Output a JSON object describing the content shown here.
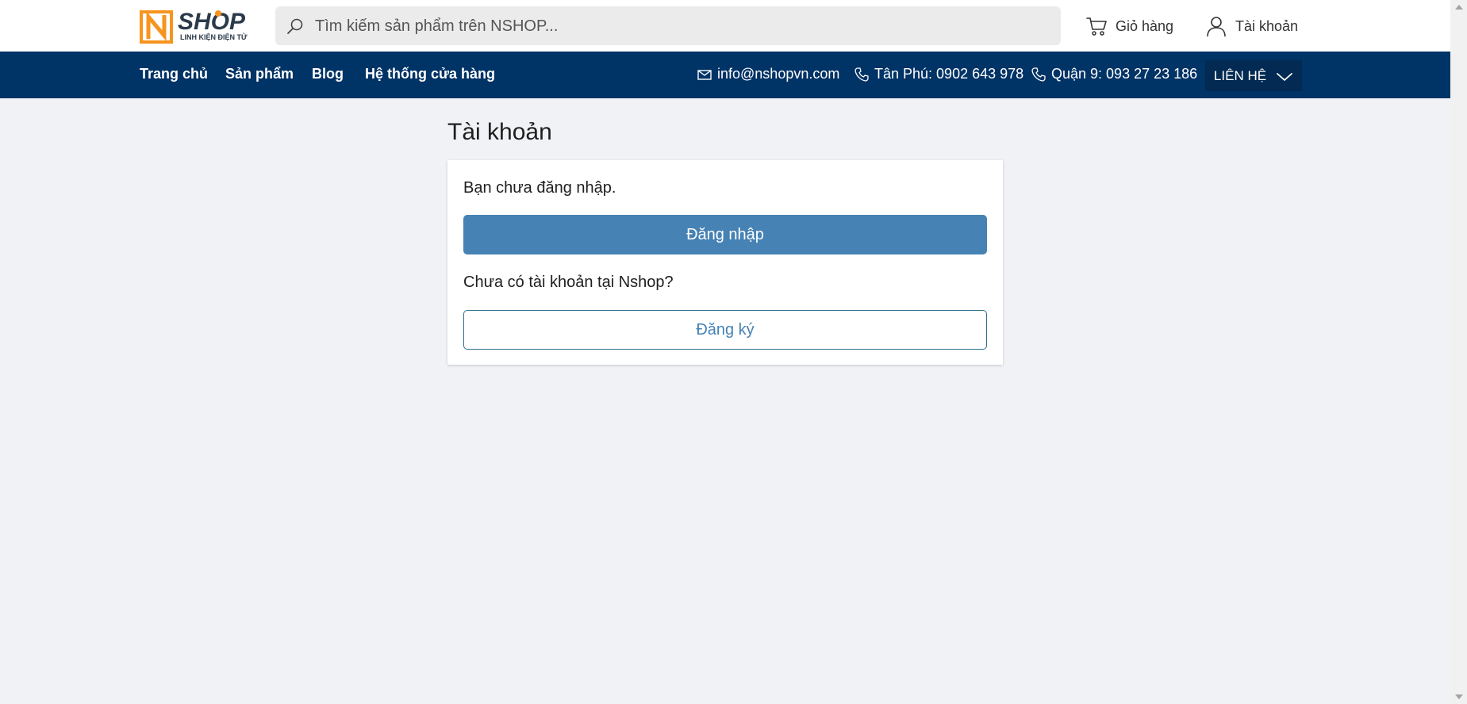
{
  "header": {
    "logo": {
      "brand": "SHOP",
      "tagline": "LINH KIỆN ĐIỆN TỬ",
      "icon": "n-logo-icon"
    },
    "search": {
      "placeholder": "Tìm kiếm sản phẩm trên NSHOP...",
      "value": "",
      "icon": "search-icon"
    },
    "cart": {
      "label": "Giỏ hàng",
      "icon": "cart-icon"
    },
    "account": {
      "label": "Tài khoản",
      "icon": "user-icon"
    }
  },
  "nav": {
    "items": [
      {
        "label": "Trang chủ"
      },
      {
        "label": "Sản phẩm"
      },
      {
        "label": "Blog"
      },
      {
        "label": "Hệ thống cửa hàng"
      }
    ],
    "contacts": [
      {
        "label": "info@nshopvn.com",
        "icon": "mail-icon"
      },
      {
        "label": "Tân Phú: 0902 643 978",
        "icon": "phone-icon"
      },
      {
        "label": "Quận 9: 093 27 23 186",
        "icon": "phone-icon"
      }
    ],
    "contact_button": {
      "label": "LIÊN HỆ",
      "icon": "chevron-down-icon"
    }
  },
  "main": {
    "title": "Tài khoản",
    "not_logged_in": "Bạn chưa đăng nhập.",
    "login_button": "Đăng nhập",
    "no_account_question": "Chưa có tài khoản tại Nshop?",
    "register_button": "Đăng ký"
  },
  "colors": {
    "navbar": "#003366",
    "contact_button": "#022a52",
    "primary_button": "#4682b4",
    "logo_orange": "#f7941d",
    "logo_dark": "#2b3a4a",
    "background": "#f0f2f5"
  }
}
